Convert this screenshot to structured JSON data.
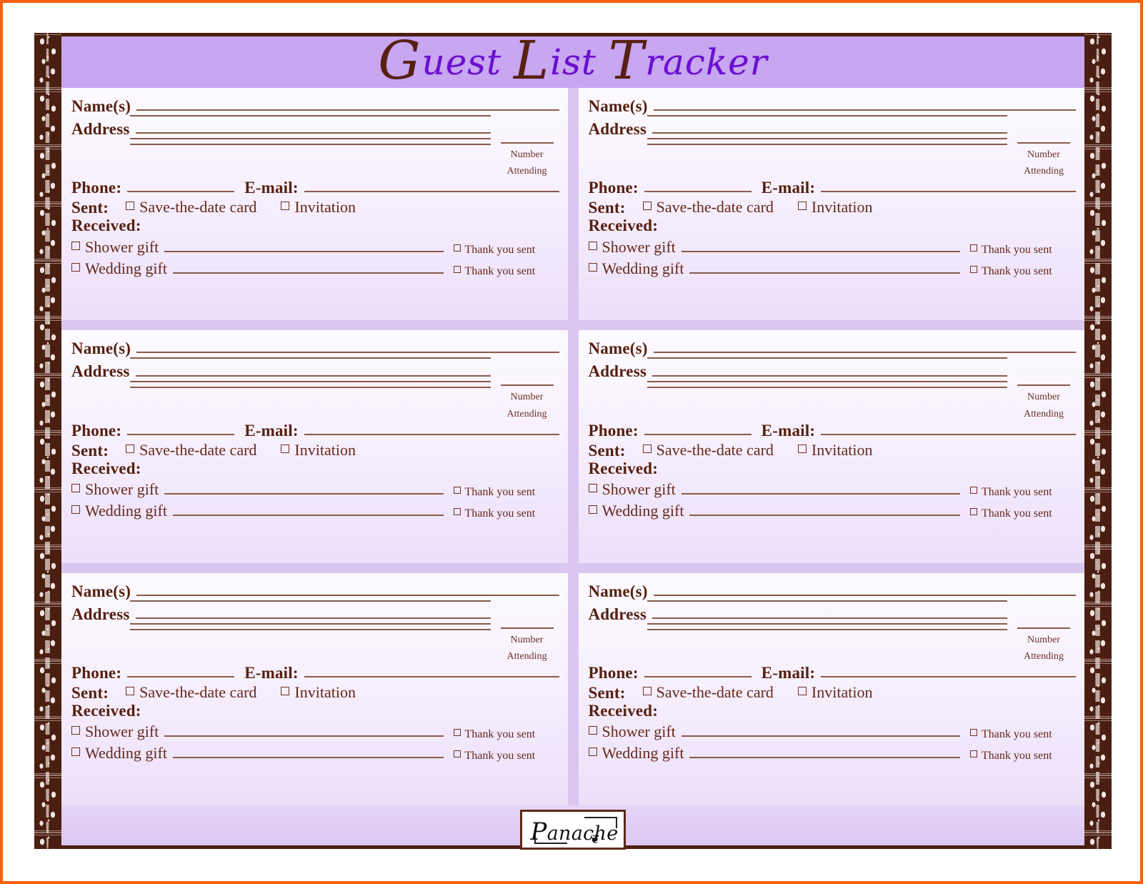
{
  "document": {
    "title_cap1": "G",
    "title_part1": "uest",
    "title_cap2": "L",
    "title_part2": "ist",
    "title_cap3": "T",
    "title_part3": "racker",
    "title_full": "Guest List Tracker"
  },
  "colors": {
    "header_band": "#c8a6f0",
    "title_script": "#6a0fd0",
    "title_cap": "#57200f",
    "border_frame": "#4a1f11",
    "label_text": "#55200f",
    "rule_line": "#8a5a4a",
    "card_top": "#fcfaff",
    "card_bottom": "#ecdffa",
    "gap_lavender": "#d9c7f0",
    "viewer_frame": "#f4620f"
  },
  "entry_labels": {
    "names": "Name(s)",
    "address": "Address",
    "number": "Number",
    "attending": "Attending",
    "phone": "Phone:",
    "email": "E-mail:",
    "sent": "Sent:",
    "save_the_date": "Save-the-date card",
    "invitation": "Invitation",
    "received": "Received:",
    "shower_gift": "Shower gift",
    "wedding_gift": "Wedding gift",
    "thank_you_sent": "Thank you sent"
  },
  "entries": [
    {
      "id": "entry-1",
      "position": "row1-left",
      "names": "",
      "address": "",
      "phone": "",
      "email": "",
      "number_attending": ""
    },
    {
      "id": "entry-2",
      "position": "row1-right",
      "names": "",
      "address": "",
      "phone": "",
      "email": "",
      "number_attending": ""
    },
    {
      "id": "entry-3",
      "position": "row2-left",
      "names": "",
      "address": "",
      "phone": "",
      "email": "",
      "number_attending": ""
    },
    {
      "id": "entry-4",
      "position": "row2-right",
      "names": "",
      "address": "",
      "phone": "",
      "email": "",
      "number_attending": ""
    },
    {
      "id": "entry-5",
      "position": "row3-left",
      "names": "",
      "address": "",
      "phone": "",
      "email": "",
      "number_attending": ""
    },
    {
      "id": "entry-6",
      "position": "row3-right",
      "names": "",
      "address": "",
      "phone": "",
      "email": "",
      "number_attending": ""
    }
  ],
  "footer": {
    "logo_cap": "P",
    "logo_rest": "anache",
    "logo_full": "Panache",
    "flourish": "❦"
  }
}
